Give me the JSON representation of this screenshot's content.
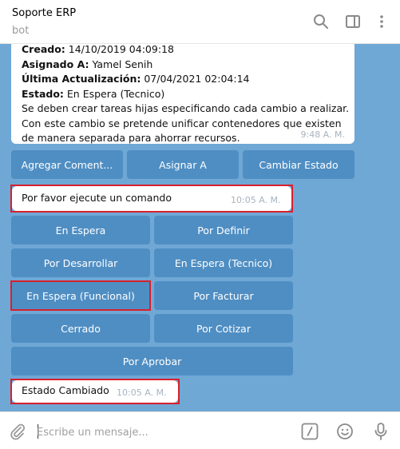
{
  "header": {
    "title": "Soporte ERP",
    "subtitle": "bot"
  },
  "message": {
    "lines": [
      {
        "label": "Creado:",
        "value": " 14/10/2019 04:09:18"
      },
      {
        "label": "Asignado A:",
        "value": " Yamel Senih"
      },
      {
        "label": "Última Actualización:",
        "value": " 07/04/2021 02:04:14"
      },
      {
        "label": "Estado:",
        "value": " En Espera (Tecnico)"
      },
      {
        "label": "",
        "value": "Se deben crear tareas hijas especificando cada cambio a realizar."
      },
      {
        "label": "",
        "value": "Con este cambio se pretende unificar contenedores que existen"
      },
      {
        "label": "",
        "value": "de manera separada para ahorrar recursos."
      }
    ],
    "time": "9:48 A. M."
  },
  "keyboard1": {
    "b1": "Agregar Coment...",
    "b2": "Asignar A",
    "b3": "Cambiar Estado"
  },
  "bubble1": {
    "text": "Por favor ejecute un comando",
    "time": "10:05 A. M."
  },
  "keyboard2": {
    "b1": "En Espera",
    "b2": "Por Definir",
    "b3": "Por Desarrollar",
    "b4": "En Espera (Tecnico)",
    "b5": "En Espera (Funcional)",
    "b6": "Por Facturar",
    "b7": "Cerrado",
    "b8": "Por Cotizar",
    "b9": "Por Aprobar"
  },
  "bubble2": {
    "text": "Estado Cambiado",
    "time": "10:05 A. M."
  },
  "composer": {
    "placeholder": "Escribe un mensaje..."
  },
  "colors": {
    "chat_bg": "#6fa7d5",
    "button": "#4f8ec3",
    "highlight": "#d8202c"
  }
}
